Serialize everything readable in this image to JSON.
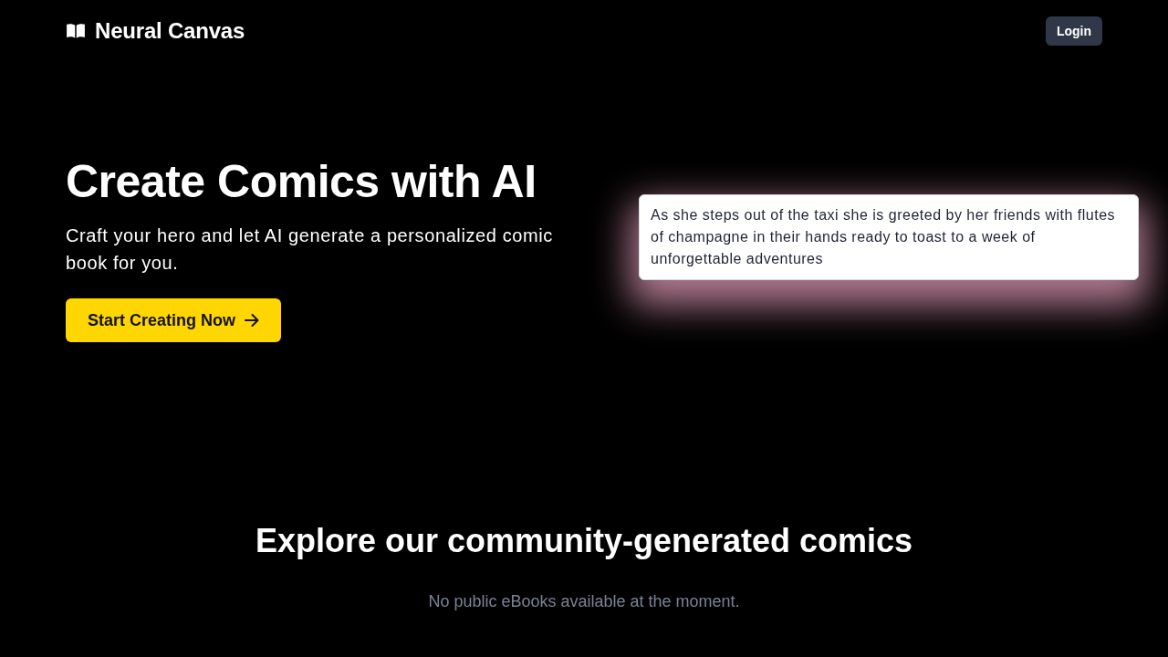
{
  "header": {
    "brand": "Neural Canvas",
    "login_button": "Login"
  },
  "hero": {
    "title": "Create Comics with AI",
    "subtitle": "Craft your hero and let AI generate a personalized comic book for you.",
    "cta_button": "Start Creating Now",
    "story_card": {
      "text": "As she steps out of the taxi she is greeted by her friends with flutes of champagne in their hands ready to toast to a week of unforgettable adventures"
    }
  },
  "community": {
    "title": "Explore our community-generated comics",
    "empty_message": "No public eBooks available at the moment."
  }
}
